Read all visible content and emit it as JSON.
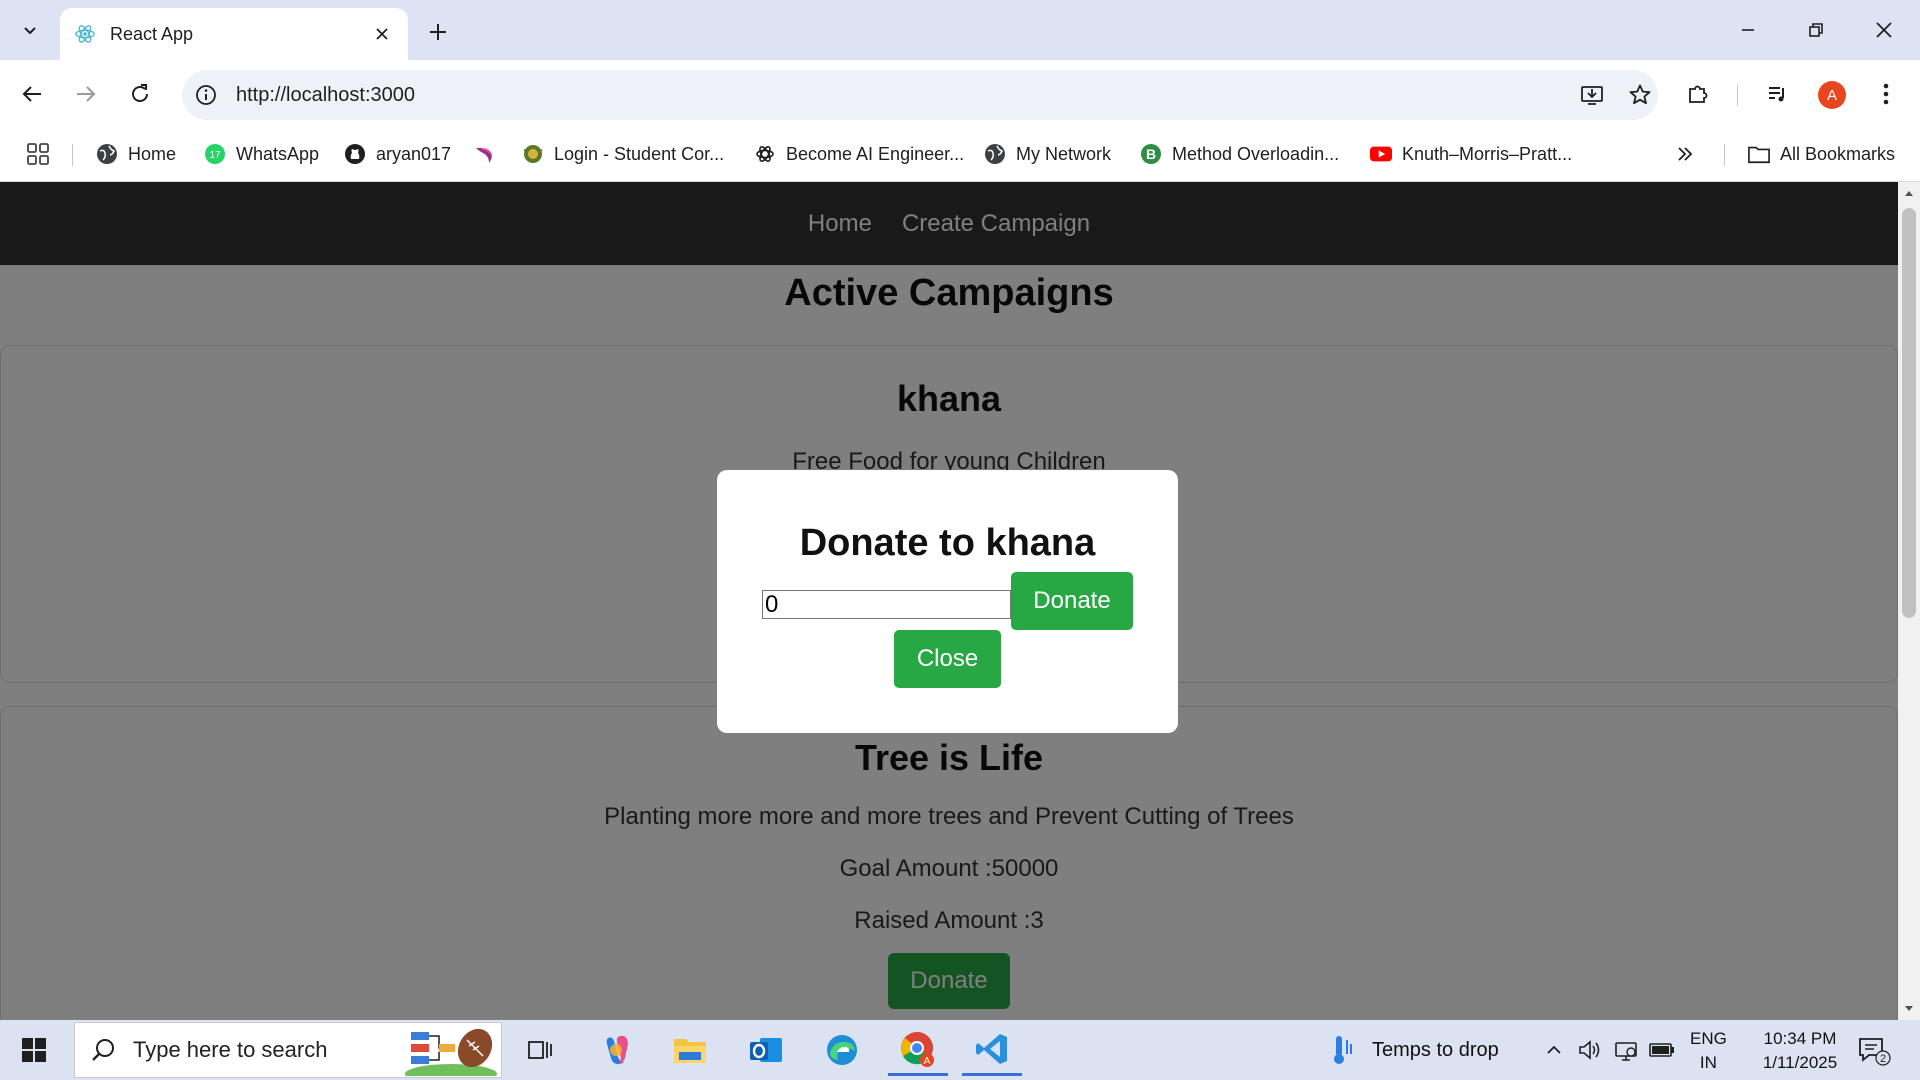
{
  "browser": {
    "tab_title": "React App",
    "url": "http://localhost:3000",
    "bookmarks": [
      {
        "label": "Home",
        "icon": "globe-icon"
      },
      {
        "label": "WhatsApp",
        "icon": "whatsapp-icon",
        "badge": "17"
      },
      {
        "label": "aryan017",
        "icon": "github-icon"
      },
      {
        "label": "",
        "icon": "bird-icon"
      },
      {
        "label": "Login - Student Cor...",
        "icon": "student-logo-icon"
      },
      {
        "label": "Become AI Engineer...",
        "icon": "openai-icon"
      },
      {
        "label": "My Network",
        "icon": "globe-icon"
      },
      {
        "label": "Method Overloadin...",
        "icon": "b-logo-icon"
      },
      {
        "label": "Knuth–Morris–Pratt...",
        "icon": "youtube-icon"
      }
    ],
    "all_bookmarks_label": "All Bookmarks",
    "profile_initial": "A"
  },
  "site": {
    "nav": {
      "home": "Home",
      "create": "Create Campaign"
    },
    "page_title": "Active Campaigns",
    "campaigns": [
      {
        "title": "khana",
        "description": "Free Food for young Children"
      },
      {
        "title": "Tree is Life",
        "description": "Planting more more and more trees and Prevent Cutting of Trees",
        "goal": "Goal Amount :50000",
        "raised": "Raised Amount :3",
        "button": "Donate"
      }
    ]
  },
  "modal": {
    "title": "Donate to khana",
    "amount_value": "0",
    "donate_label": "Donate",
    "close_label": "Close"
  },
  "taskbar": {
    "search_placeholder": "Type here to search",
    "weather": "Temps to drop",
    "lang_top": "ENG",
    "lang_bottom": "IN",
    "time": "10:34 PM",
    "date": "1/11/2025",
    "notification_count": "2"
  },
  "colors": {
    "accent_green": "#28a745",
    "site_nav_bg": "#333333",
    "chrome_bg": "#dde3f3"
  }
}
